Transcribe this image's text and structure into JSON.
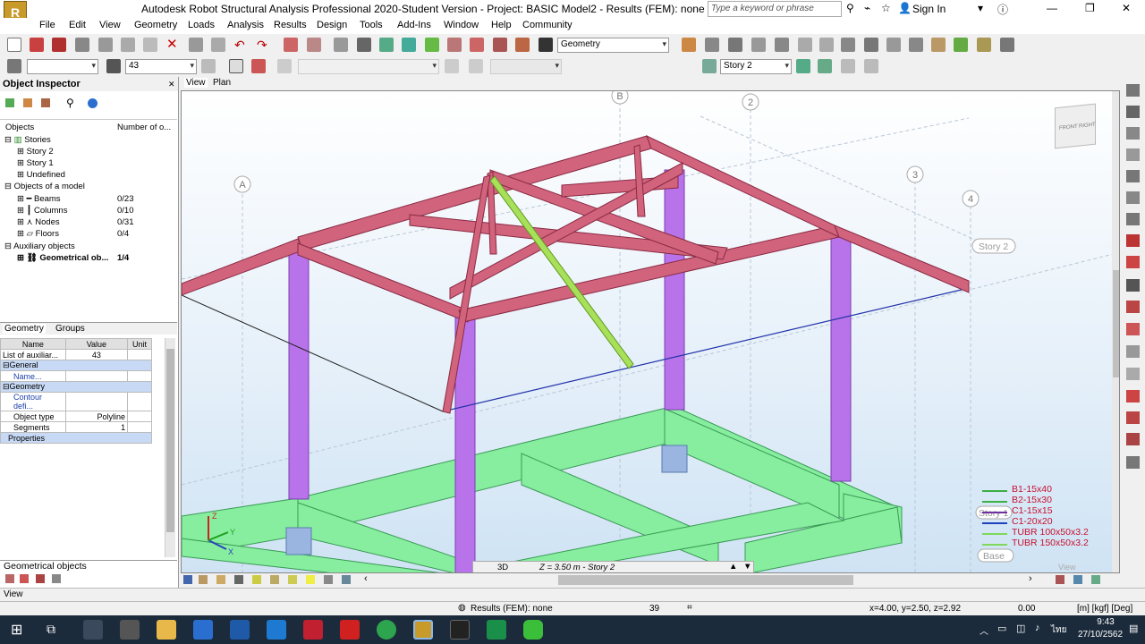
{
  "window": {
    "title": "Autodesk Robot Structural Analysis Professional 2020-Student Version - Project: BASIC Model2 - Results (FEM): none",
    "search_placeholder": "Type a keyword or phrase",
    "sign_in": "Sign In",
    "logo": "R"
  },
  "menu": [
    "File",
    "Edit",
    "View",
    "Geometry",
    "Loads",
    "Analysis",
    "Results",
    "Design",
    "Tools",
    "Add-Ins",
    "Window",
    "Help",
    "Community"
  ],
  "toolbar": {
    "layout_combo": "Geometry",
    "selection_value": "43",
    "story_combo": "Story 2"
  },
  "inspector": {
    "title": "Object Inspector",
    "col_objects": "Objects",
    "col_number": "Number of o...",
    "tree": [
      {
        "label": "Stories",
        "num": ""
      },
      {
        "label": "Story 2",
        "num": ""
      },
      {
        "label": "Story 1",
        "num": ""
      },
      {
        "label": "Undefined",
        "num": ""
      },
      {
        "label": "Objects of a model",
        "num": ""
      },
      {
        "label": "Beams",
        "num": "0/23"
      },
      {
        "label": "Columns",
        "num": "0/10"
      },
      {
        "label": "Nodes",
        "num": "0/31"
      },
      {
        "label": "Floors",
        "num": "0/4"
      },
      {
        "label": "Auxiliary objects",
        "num": ""
      },
      {
        "label": "Geometrical ob...",
        "num": "1/4"
      }
    ],
    "tabs": [
      "Geometry",
      "Groups"
    ],
    "props_header": [
      "Name",
      "Value",
      "Unit"
    ],
    "props": [
      {
        "name": "List of auxiliar...",
        "value": "43",
        "unit": ""
      },
      {
        "name": "General",
        "value": "",
        "unit": ""
      },
      {
        "name": "Name...",
        "value": "",
        "unit": ""
      },
      {
        "name": "Geometry",
        "value": "",
        "unit": ""
      },
      {
        "name": "Contour defi...",
        "value": "",
        "unit": ""
      },
      {
        "name": "Object type",
        "value": "Polyline",
        "unit": ""
      },
      {
        "name": "Segments",
        "value": "1",
        "unit": ""
      },
      {
        "name": "Properties",
        "value": "",
        "unit": ""
      }
    ],
    "bottom_tab": "Geometrical objects"
  },
  "view_tabs": [
    "View",
    "Plan"
  ],
  "viewport": {
    "axis_labels": [
      "A",
      "B",
      "2",
      "3",
      "4"
    ],
    "story_label": "Story 2",
    "story_label_lower": "Story 1",
    "base_label": "Base",
    "mode": "3D",
    "z_level": "Z = 3.50 m - Story 2",
    "view_label": "View",
    "viewcube_faces": [
      "FRONT",
      "RIGHT"
    ],
    "legend": [
      {
        "label": "B1-15x40",
        "color": "#3cb043"
      },
      {
        "label": "B2-15x30",
        "color": "#3cb043"
      },
      {
        "label": "C1-15x15",
        "color": "#7030a0"
      },
      {
        "label": "C1-20x20",
        "color": "#1f3fbf"
      },
      {
        "label": "TUBR 100x50x3.2",
        "color": "#7ed957"
      },
      {
        "label": "TUBR 150x50x3.2",
        "color": "#7ed957"
      }
    ]
  },
  "status": {
    "view": "View",
    "results": "Results (FEM): none",
    "count": "39",
    "coords": "x=4.00, y=2.50, z=2.92",
    "value": "0.00",
    "units": "[m] [kgf] [Deg]"
  },
  "taskbar": {
    "time": "9:43",
    "date": "27/10/2562",
    "lang": "ไทย"
  },
  "colors": {
    "beam": "#c8546e",
    "column": "#b06ee0",
    "foundation": "#7eeb9a",
    "brace": "#a8e05a"
  }
}
